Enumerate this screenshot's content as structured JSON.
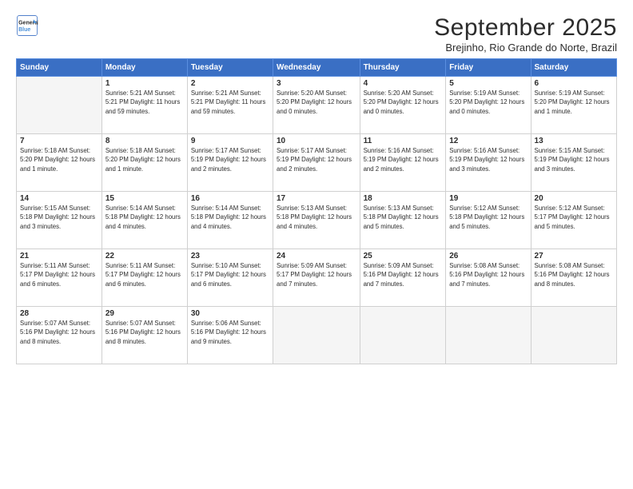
{
  "logo": {
    "line1": "General",
    "line2": "Blue"
  },
  "title": "September 2025",
  "subtitle": "Brejinho, Rio Grande do Norte, Brazil",
  "days_of_week": [
    "Sunday",
    "Monday",
    "Tuesday",
    "Wednesday",
    "Thursday",
    "Friday",
    "Saturday"
  ],
  "weeks": [
    [
      {
        "day": "",
        "detail": "",
        "empty": true
      },
      {
        "day": "1",
        "detail": "Sunrise: 5:21 AM\nSunset: 5:21 PM\nDaylight: 11 hours\nand 59 minutes."
      },
      {
        "day": "2",
        "detail": "Sunrise: 5:21 AM\nSunset: 5:21 PM\nDaylight: 11 hours\nand 59 minutes."
      },
      {
        "day": "3",
        "detail": "Sunrise: 5:20 AM\nSunset: 5:20 PM\nDaylight: 12 hours\nand 0 minutes."
      },
      {
        "day": "4",
        "detail": "Sunrise: 5:20 AM\nSunset: 5:20 PM\nDaylight: 12 hours\nand 0 minutes."
      },
      {
        "day": "5",
        "detail": "Sunrise: 5:19 AM\nSunset: 5:20 PM\nDaylight: 12 hours\nand 0 minutes."
      },
      {
        "day": "6",
        "detail": "Sunrise: 5:19 AM\nSunset: 5:20 PM\nDaylight: 12 hours\nand 1 minute."
      }
    ],
    [
      {
        "day": "7",
        "detail": "Sunrise: 5:18 AM\nSunset: 5:20 PM\nDaylight: 12 hours\nand 1 minute."
      },
      {
        "day": "8",
        "detail": "Sunrise: 5:18 AM\nSunset: 5:20 PM\nDaylight: 12 hours\nand 1 minute."
      },
      {
        "day": "9",
        "detail": "Sunrise: 5:17 AM\nSunset: 5:19 PM\nDaylight: 12 hours\nand 2 minutes."
      },
      {
        "day": "10",
        "detail": "Sunrise: 5:17 AM\nSunset: 5:19 PM\nDaylight: 12 hours\nand 2 minutes."
      },
      {
        "day": "11",
        "detail": "Sunrise: 5:16 AM\nSunset: 5:19 PM\nDaylight: 12 hours\nand 2 minutes."
      },
      {
        "day": "12",
        "detail": "Sunrise: 5:16 AM\nSunset: 5:19 PM\nDaylight: 12 hours\nand 3 minutes."
      },
      {
        "day": "13",
        "detail": "Sunrise: 5:15 AM\nSunset: 5:19 PM\nDaylight: 12 hours\nand 3 minutes."
      }
    ],
    [
      {
        "day": "14",
        "detail": "Sunrise: 5:15 AM\nSunset: 5:18 PM\nDaylight: 12 hours\nand 3 minutes."
      },
      {
        "day": "15",
        "detail": "Sunrise: 5:14 AM\nSunset: 5:18 PM\nDaylight: 12 hours\nand 4 minutes."
      },
      {
        "day": "16",
        "detail": "Sunrise: 5:14 AM\nSunset: 5:18 PM\nDaylight: 12 hours\nand 4 minutes."
      },
      {
        "day": "17",
        "detail": "Sunrise: 5:13 AM\nSunset: 5:18 PM\nDaylight: 12 hours\nand 4 minutes."
      },
      {
        "day": "18",
        "detail": "Sunrise: 5:13 AM\nSunset: 5:18 PM\nDaylight: 12 hours\nand 5 minutes."
      },
      {
        "day": "19",
        "detail": "Sunrise: 5:12 AM\nSunset: 5:18 PM\nDaylight: 12 hours\nand 5 minutes."
      },
      {
        "day": "20",
        "detail": "Sunrise: 5:12 AM\nSunset: 5:17 PM\nDaylight: 12 hours\nand 5 minutes."
      }
    ],
    [
      {
        "day": "21",
        "detail": "Sunrise: 5:11 AM\nSunset: 5:17 PM\nDaylight: 12 hours\nand 6 minutes."
      },
      {
        "day": "22",
        "detail": "Sunrise: 5:11 AM\nSunset: 5:17 PM\nDaylight: 12 hours\nand 6 minutes."
      },
      {
        "day": "23",
        "detail": "Sunrise: 5:10 AM\nSunset: 5:17 PM\nDaylight: 12 hours\nand 6 minutes."
      },
      {
        "day": "24",
        "detail": "Sunrise: 5:09 AM\nSunset: 5:17 PM\nDaylight: 12 hours\nand 7 minutes."
      },
      {
        "day": "25",
        "detail": "Sunrise: 5:09 AM\nSunset: 5:16 PM\nDaylight: 12 hours\nand 7 minutes."
      },
      {
        "day": "26",
        "detail": "Sunrise: 5:08 AM\nSunset: 5:16 PM\nDaylight: 12 hours\nand 7 minutes."
      },
      {
        "day": "27",
        "detail": "Sunrise: 5:08 AM\nSunset: 5:16 PM\nDaylight: 12 hours\nand 8 minutes."
      }
    ],
    [
      {
        "day": "28",
        "detail": "Sunrise: 5:07 AM\nSunset: 5:16 PM\nDaylight: 12 hours\nand 8 minutes."
      },
      {
        "day": "29",
        "detail": "Sunrise: 5:07 AM\nSunset: 5:16 PM\nDaylight: 12 hours\nand 8 minutes."
      },
      {
        "day": "30",
        "detail": "Sunrise: 5:06 AM\nSunset: 5:16 PM\nDaylight: 12 hours\nand 9 minutes."
      },
      {
        "day": "",
        "detail": "",
        "empty": true
      },
      {
        "day": "",
        "detail": "",
        "empty": true
      },
      {
        "day": "",
        "detail": "",
        "empty": true
      },
      {
        "day": "",
        "detail": "",
        "empty": true
      }
    ]
  ]
}
